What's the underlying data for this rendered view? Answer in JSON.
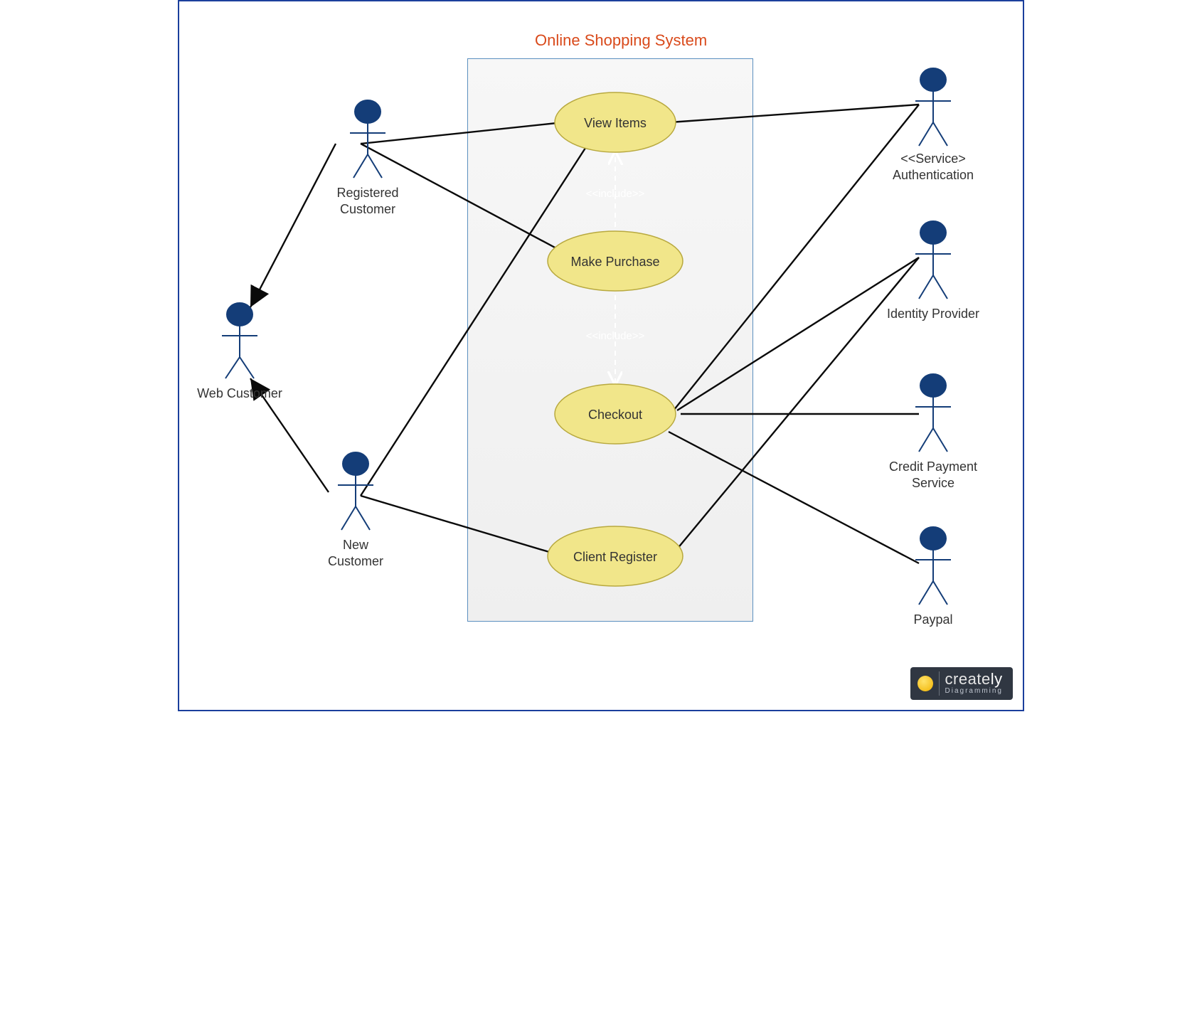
{
  "diagram": {
    "title": "Online Shopping System",
    "system_boundary": "Online Shopping System",
    "actors": {
      "web_customer": "Web Customer",
      "registered_customer": "Registered\nCustomer",
      "new_customer": "New\nCustomer",
      "authentication": "<<Service>\nAuthentication",
      "identity_provider": "Identity Provider",
      "credit_payment": "Credit Payment\nService",
      "paypal": "Paypal"
    },
    "usecases": {
      "view_items": "View Items",
      "make_purchase": "Make Purchase",
      "checkout": "Checkout",
      "client_register": "Client Register"
    },
    "includes": {
      "label1": "<<include>>",
      "label2": "<<include>>"
    },
    "associations": [
      [
        "registered_customer",
        "view_items"
      ],
      [
        "registered_customer",
        "make_purchase"
      ],
      [
        "new_customer",
        "view_items"
      ],
      [
        "new_customer",
        "client_register"
      ],
      [
        "view_items",
        "authentication"
      ],
      [
        "checkout",
        "authentication"
      ],
      [
        "checkout",
        "identity_provider"
      ],
      [
        "checkout",
        "credit_payment"
      ],
      [
        "checkout",
        "paypal"
      ],
      [
        "client_register",
        "identity_provider"
      ]
    ],
    "generalizations": [
      [
        "registered_customer",
        "web_customer"
      ],
      [
        "new_customer",
        "web_customer"
      ]
    ],
    "include_relations": [
      [
        "make_purchase",
        "view_items"
      ],
      [
        "make_purchase",
        "checkout"
      ]
    ]
  },
  "branding": {
    "name_a": "create",
    "name_b": "ly",
    "tagline": "Diagramming"
  }
}
